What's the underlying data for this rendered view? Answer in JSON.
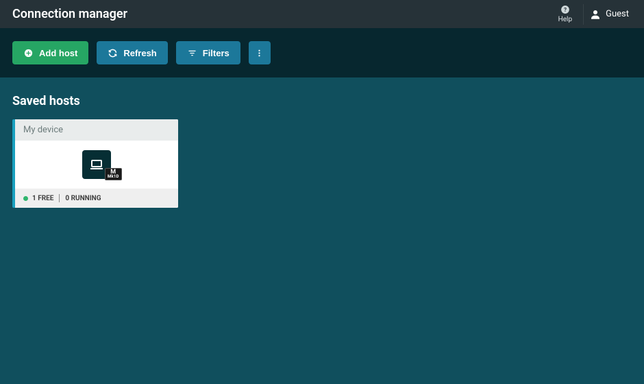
{
  "header": {
    "title": "Connection manager",
    "help_label": "Help",
    "user_name": "Guest"
  },
  "toolbar": {
    "add_host_label": "Add host",
    "refresh_label": "Refresh",
    "filters_label": "Filters"
  },
  "sections": {
    "saved_hosts_title": "Saved hosts"
  },
  "hosts": [
    {
      "name": "My device",
      "badge_top": "M",
      "badge_bottom": "Mk1D",
      "free_text": "1 FREE",
      "running_text": "0 RUNNING",
      "status_color": "#2fb56d"
    }
  ]
}
